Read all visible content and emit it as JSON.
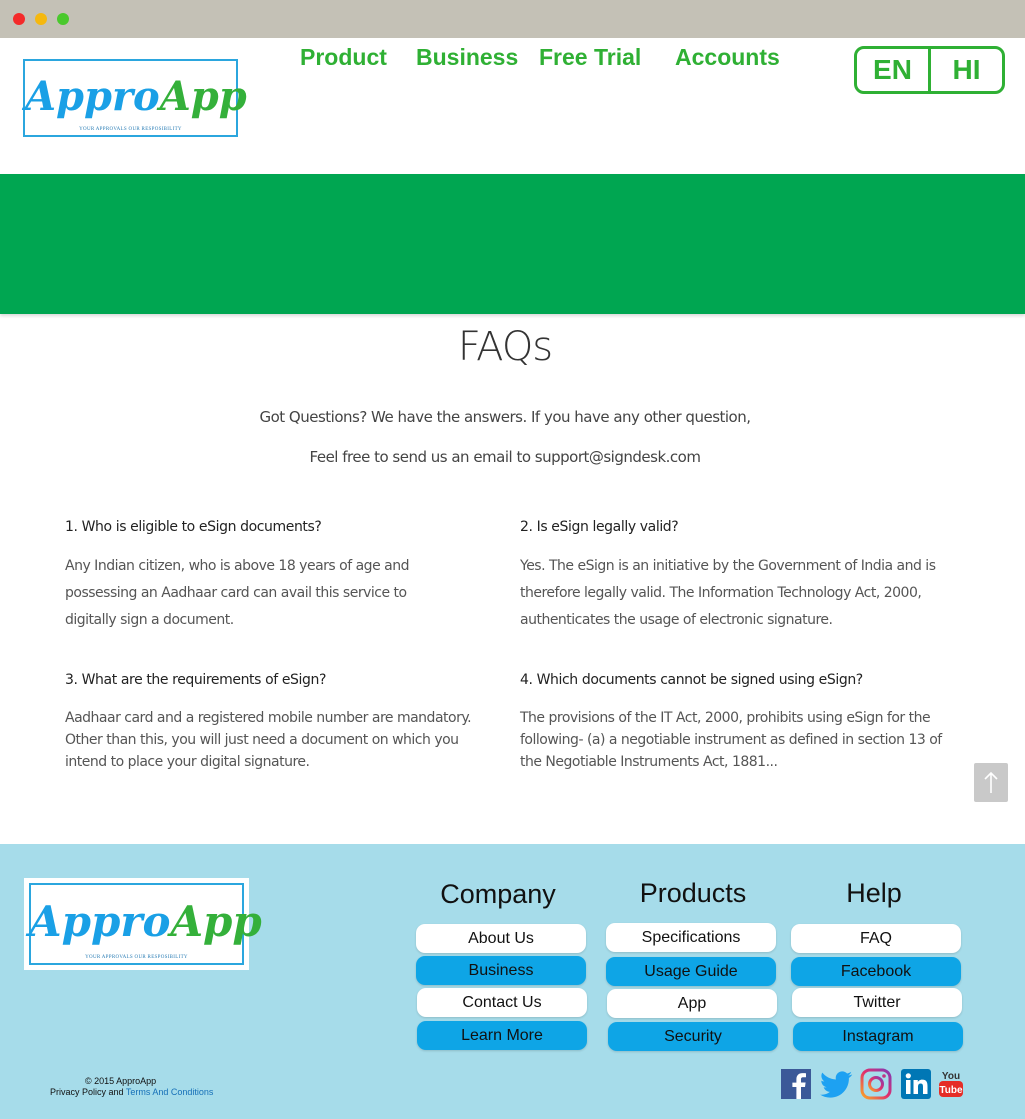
{
  "brand": {
    "name_part1": "Appro",
    "name_part2": "App",
    "tagline": "YOUR APPROVALS OUR RESPOSIBILITY"
  },
  "nav": {
    "items": [
      "Product",
      "Business",
      "Free Trial",
      "Accounts"
    ]
  },
  "language": {
    "en": "EN",
    "hi": "HI"
  },
  "faq": {
    "title": "FAQs",
    "intro_line1": "Got Questions? We have the answers. If you have any other question,",
    "intro_line2": "Feel free to send us an email to support@signdesk.com",
    "items": [
      {
        "question": "1.  Who is eligible to eSign documents?",
        "answer": "Any Indian citizen, who is above 18 years of age and possessing an Aadhaar card can avail this service to digitally sign a document."
      },
      {
        "question": "2.  Is eSign legally valid?",
        "answer": "Yes. The eSign is an initiative by the Government of India and is therefore legally valid. The Information Technology Act, 2000, authenticates the usage of electronic signature."
      },
      {
        "question": " 3. What are the requirements of eSign?",
        "answer": "Aadhaar card and a registered mobile number are mandatory. Other than this, you will just need a document on which you intend to place your digital signature."
      },
      {
        "question": "4. Which documents cannot be signed using eSign?",
        "answer": "The provisions of the IT Act, 2000, prohibits using eSign for the following- (a) a negotiable instrument as defined in section 13 of the Negotiable Instruments Act, 1881..."
      }
    ]
  },
  "scroll_top_icon": "arrow-up-icon",
  "footer": {
    "columns": [
      {
        "title": "Company",
        "links": [
          "About Us",
          "Business",
          "Contact Us",
          "Learn More"
        ]
      },
      {
        "title": "Products",
        "links": [
          "Specifications",
          "Usage Guide",
          "App",
          "Security"
        ]
      },
      {
        "title": "Help",
        "links": [
          "FAQ",
          "Facebook",
          "Twitter",
          "Instagram"
        ]
      }
    ],
    "copyright": "© 2015  ApproApp",
    "privacy_prefix": "Privacy Policy and ",
    "terms": "Terms And Conditions",
    "social": [
      "facebook-icon",
      "twitter-icon",
      "instagram-icon",
      "linkedin-icon",
      "youtube-icon"
    ]
  },
  "colors": {
    "brand_green": "#2fb034",
    "banner_green": "#00a651",
    "brand_blue": "#1aa0e6",
    "footer_bg": "#a6dcea",
    "pill_blue": "#0ea5e6"
  }
}
